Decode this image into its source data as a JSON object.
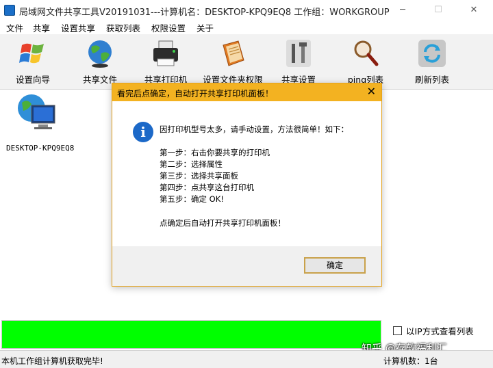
{
  "window": {
    "title": "局域网文件共享工具V20191031---计算机名：DESKTOP-KPQ9EQ8  工作组：WORKGROUP",
    "minimize": "─",
    "maximize": "☐",
    "close": "✕"
  },
  "menu": [
    "文件",
    "共享",
    "设置共享",
    "获取列表",
    "权限设置",
    "关于"
  ],
  "toolbar": [
    {
      "label": "设置向导",
      "icon": "windows-flag-icon"
    },
    {
      "label": "共享文件",
      "icon": "globe-icon"
    },
    {
      "label": "共享打印机",
      "icon": "printer-icon"
    },
    {
      "label": "设置文件夹权限",
      "icon": "folder-permission-icon"
    },
    {
      "label": "共享设置",
      "icon": "tools-icon"
    },
    {
      "label": "ping列表",
      "icon": "magnifier-icon"
    },
    {
      "label": "刷新列表",
      "icon": "refresh-icon"
    }
  ],
  "computer": {
    "name": "DESKTOP-KPQ9EQ8"
  },
  "dialog": {
    "title": "看完后点确定，自动打开共享打印机面板！",
    "close": "✕",
    "lines": [
      "因打印机型号太多，请手动设置，方法很简单！如下：",
      "第一步：右击你要共享的打印机",
      "第二步：选择属性",
      "第三步：选择共享面板",
      "第四步：点共享这台打印机",
      "第五步：确定  OK!",
      "点确定后自动打开共享打印机面板！"
    ],
    "ok_label": "确定"
  },
  "progress": {
    "fraction": 1.0,
    "color": "#00ff00"
  },
  "options": {
    "ip_view": "以IP方式查看列表",
    "ip_view_checked": false
  },
  "watermark": "知乎 @存软福利汇",
  "status": {
    "left": "本机工作组计算机获取完毕!",
    "right": "计算机数：1台"
  },
  "colors": {
    "dialog_title_bar": "#f3b221",
    "info_icon": "#1c69c8"
  }
}
